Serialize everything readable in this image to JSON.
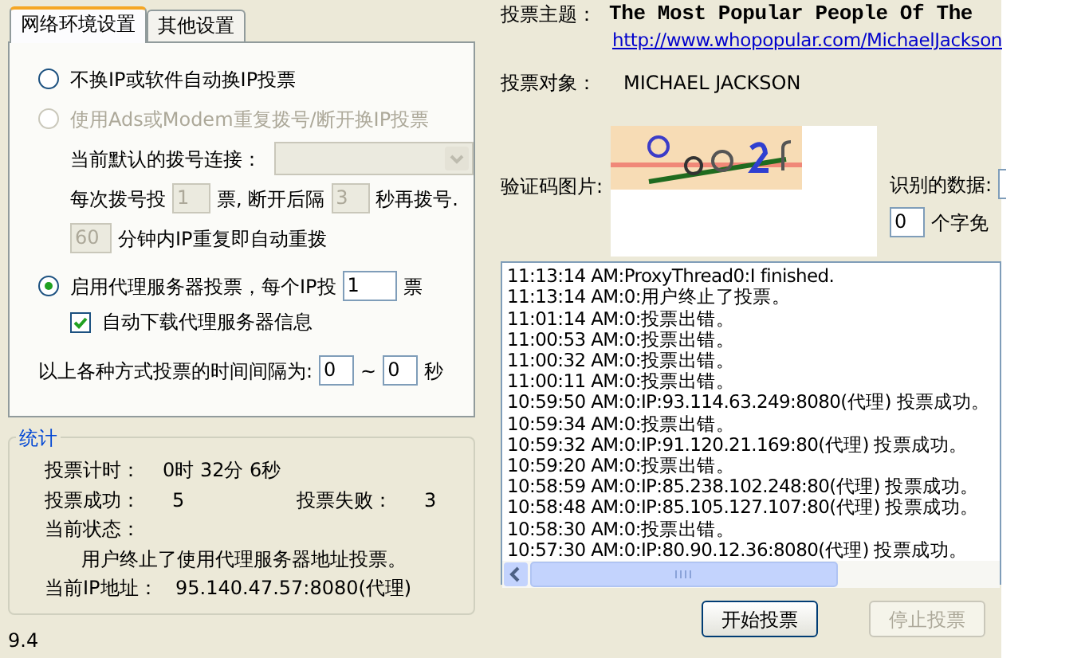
{
  "tabs": [
    {
      "label": "网络环境设置",
      "selected": true
    },
    {
      "label": "其他设置",
      "selected": false
    }
  ],
  "network": {
    "direct": {
      "label": "不换IP或软件自动换IP投票",
      "selected": false,
      "disabled": false
    },
    "dialup": {
      "label": "使用Ads或Modem重复拨号/断开换IP投票",
      "selected": false,
      "disabled": true
    },
    "connection_label": "当前默认的拨号连接：",
    "per_dial_label": "每次拨号投",
    "per_dial_value": "1",
    "wait_label": "票, 断开后隔",
    "wait_value": "3",
    "wait_unit": "秒再拨号.",
    "repeat_value": "60",
    "repeat_label": "分钟内IP重复即自动重拨",
    "proxy": {
      "label": "启用代理服务器投票，每个IP投",
      "selected": true,
      "disabled": false
    },
    "proxy_value": "1",
    "proxy_unit": "票",
    "auto_download": {
      "label": "自动下载代理服务器信息",
      "checked": true
    },
    "interval_label": "以上各种方式投票的时间间隔为:",
    "interval_from": "0",
    "interval_sep": "~",
    "interval_to": "0",
    "interval_unit": "秒"
  },
  "stats": {
    "title": "统计",
    "timer_label": "投票计时：",
    "timer": "0时 32分 6秒",
    "success_label": "投票成功：",
    "success": "5",
    "fail_label": "投票失败：",
    "fail": "3",
    "status_label": "当前状态：",
    "status": "用户终止了使用代理服务器地址投票。",
    "ip_label": "当前IP地址：",
    "ip": "95.140.47.57:8080(代理)"
  },
  "version": "9.4",
  "vote": {
    "topic_label": "投票主题：",
    "topic": "The Most Popular People Of The",
    "url": "http://www.whopopular.com/MichaelJackson",
    "target_label": "投票对象：",
    "target": "MICHAEL JACKSON",
    "captcha_label": "验证码图片:",
    "recognized_label": "识别的数据:",
    "free_value": "0",
    "free_label": "个字免"
  },
  "log": [
    "11:13:14 AM:ProxyThread0:I finished.",
    "11:13:14 AM:0:用户终止了投票。",
    "11:01:14 AM:0:投票出错。",
    "11:00:53 AM:0:投票出错。",
    "11:00:32 AM:0:投票出错。",
    "11:00:11 AM:0:投票出错。",
    "10:59:50 AM:0:IP:93.114.63.249:8080(代理) 投票成功。",
    "10:59:34 AM:0:投票出错。",
    "10:59:32 AM:0:IP:91.120.21.169:80(代理) 投票成功。",
    "10:59:20 AM:0:投票出错。",
    "10:58:59 AM:0:IP:85.238.102.248:80(代理) 投票成功。",
    "10:58:48 AM:0:IP:85.105.127.107:80(代理) 投票成功。",
    "10:58:30 AM:0:投票出错。",
    "10:57:30 AM:0:IP:80.90.12.36:8080(代理) 投票成功。"
  ],
  "buttons": [
    {
      "label": "开始投票",
      "disabled": false
    },
    {
      "label": "停止投票",
      "disabled": true
    }
  ]
}
